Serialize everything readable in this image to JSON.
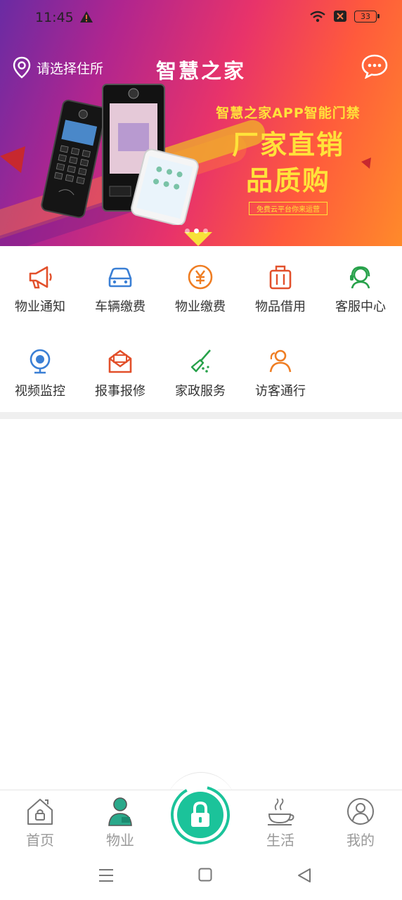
{
  "status_bar": {
    "time": "11:45",
    "battery": "33"
  },
  "header": {
    "location_label": "请选择住所",
    "app_title": "智慧之家"
  },
  "banner": {
    "promo_line1": "智慧之家APP智能门禁",
    "promo_line2": "厂家直销",
    "promo_line3": "品质购",
    "promo_tag": "免费云平台你来运营"
  },
  "services": [
    {
      "label": "物业通知",
      "icon": "megaphone-icon"
    },
    {
      "label": "车辆缴费",
      "icon": "car-icon"
    },
    {
      "label": "物业缴费",
      "icon": "yen-coin-icon"
    },
    {
      "label": "物品借用",
      "icon": "suitcase-icon"
    },
    {
      "label": "客服中心",
      "icon": "headset-icon"
    },
    {
      "label": "视频监控",
      "icon": "camera-icon"
    },
    {
      "label": "报事报修",
      "icon": "envelope-icon"
    },
    {
      "label": "家政服务",
      "icon": "broom-icon"
    },
    {
      "label": "访客通行",
      "icon": "visitors-icon"
    }
  ],
  "tabs": [
    {
      "label": "首页",
      "icon": "home-icon"
    },
    {
      "label": "物业",
      "icon": "property-person-icon"
    },
    {
      "label": "生活",
      "icon": "coffee-cup-icon"
    },
    {
      "label": "我的",
      "icon": "user-circle-icon"
    }
  ],
  "colors": {
    "accent": "#1bc39a",
    "banner_yellow": "#ffe23a",
    "tab_inactive": "#999999"
  }
}
